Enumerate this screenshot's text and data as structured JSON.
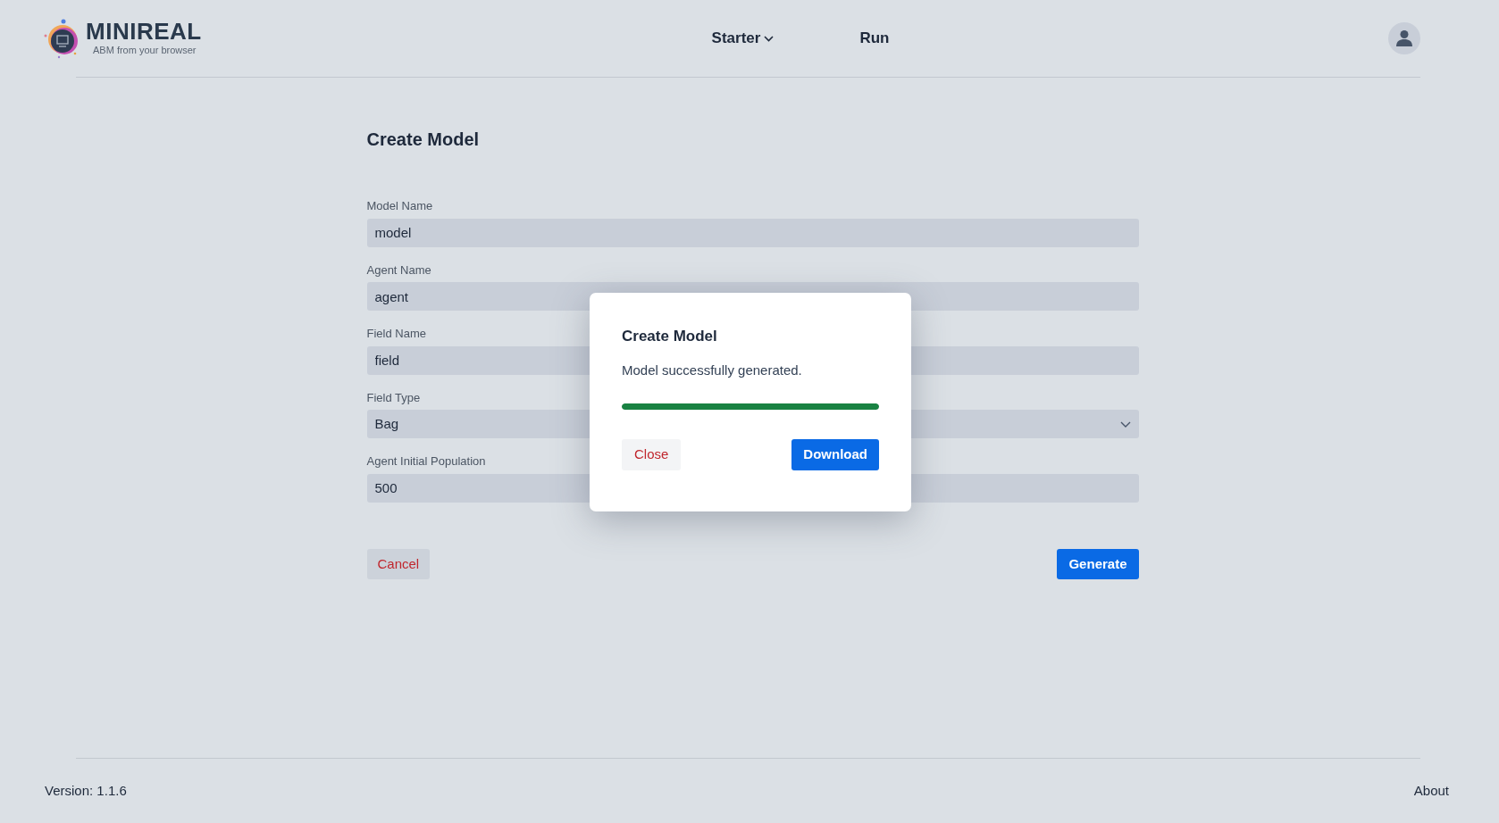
{
  "header": {
    "logo_title": "MINIREAL",
    "logo_subtitle": "ABM from your browser",
    "nav": [
      {
        "label": "Starter",
        "kind": "dropdown"
      },
      {
        "label": "Run",
        "kind": "link"
      }
    ]
  },
  "form": {
    "title": "Create Model",
    "fields": [
      {
        "label": "Model Name",
        "value": "model",
        "kind": "text"
      },
      {
        "label": "Agent Name",
        "value": "agent",
        "kind": "text"
      },
      {
        "label": "Field Name",
        "value": "field",
        "kind": "text"
      },
      {
        "label": "Field Type",
        "value": "Bag",
        "kind": "select"
      },
      {
        "label": "Agent Initial Population",
        "value": "500",
        "kind": "text"
      }
    ],
    "cancel_button": "Cancel",
    "submit_button": "Generate"
  },
  "modal": {
    "title": "Create Model",
    "message": "Model successfully generated.",
    "progress": {
      "level": 1
    },
    "close_button": "Close",
    "download_button": "Download"
  },
  "footer": {
    "version": "Version: 1.1.6",
    "about_link": "About"
  }
}
